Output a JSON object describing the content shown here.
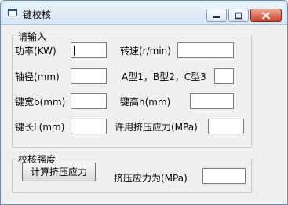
{
  "window": {
    "title": "键校核"
  },
  "input_group": {
    "legend": "请输入",
    "power_label": "功率(KW)",
    "power_value": "",
    "speed_label": "转速(r/min)",
    "speed_value": "",
    "shaft_diameter_label": "轴径(mm)",
    "shaft_diameter_value": "",
    "key_type_label": "A型1，B型2，C型3",
    "key_type_value": "",
    "key_width_label": "键宽b(mm)",
    "key_width_value": "",
    "key_height_label": "键高h(mm)",
    "key_height_value": "",
    "key_length_label": "键长L(mm)",
    "key_length_value": "",
    "allowable_stress_label": "许用挤压应力(MPa)",
    "allowable_stress_value": ""
  },
  "check_group": {
    "legend": "校核强度",
    "calc_button_label": "计算挤压应力",
    "result_label": "挤压应力为(MPa)",
    "result_value": ""
  }
}
